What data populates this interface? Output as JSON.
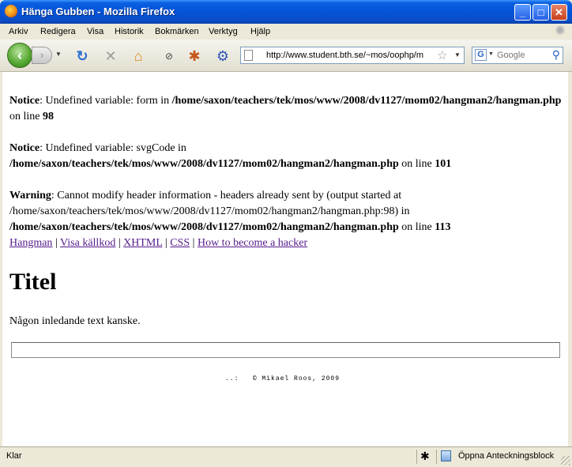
{
  "window": {
    "title": "Hänga Gubben - Mozilla Firefox"
  },
  "menu": [
    "Arkiv",
    "Redigera",
    "Visa",
    "Historik",
    "Bokmärken",
    "Verktyg",
    "Hjälp"
  ],
  "toolbar": {
    "url": "http://www.student.bth.se/~mos/oophp/m",
    "search_placeholder": "Google",
    "search_engine": "G"
  },
  "page": {
    "errors": [
      {
        "label": "Notice",
        "message": ": Undefined variable: form in ",
        "path": "/home/saxon/teachers/tek/mos/www/2008/dv1127/mom02/hangman2/hangman.php",
        "on_line": " on line ",
        "line": "98"
      },
      {
        "label": "Notice",
        "message": ": Undefined variable: svgCode in ",
        "path": "/home/saxon/teachers/tek/mos/www/2008/dv1127/mom02/hangman2/hangman.php",
        "on_line": " on line ",
        "line": "101"
      },
      {
        "label": "Warning",
        "message": ": Cannot modify header information - headers already sent by (output started at /home/saxon/teachers/tek/mos/www/2008/dv1127/mom02/hangman2/hangman.php:98) in ",
        "path": "/home/saxon/teachers/tek/mos/www/2008/dv1127/mom02/hangman2/hangman.php",
        "on_line": " on line ",
        "line": "113"
      }
    ],
    "links": [
      "Hangman",
      "Visa källkod",
      "XHTML",
      "CSS",
      "How to become a hacker"
    ],
    "separator": " | ",
    "heading": "Titel",
    "intro": "Någon inledande text kanske.",
    "footer_dots": "..:",
    "footer": "© Mikael Roos, 2009"
  },
  "status": {
    "text": "Klar",
    "notebook": "Öppna Anteckningsblock"
  },
  "colors": {
    "titlebar": "#0554d8",
    "visited_link": "#551a8b",
    "chrome": "#ece9d8"
  }
}
